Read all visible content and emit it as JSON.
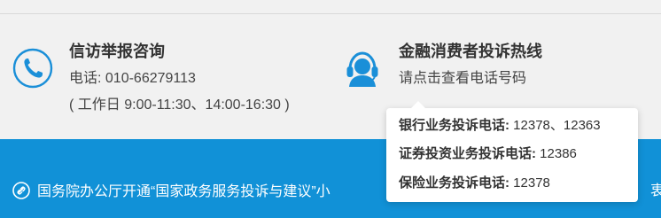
{
  "petition": {
    "title": "信访举报咨询",
    "phone": "电话: 010-66279113",
    "hours": "( 工作日 9:00-11:30、14:00-16:30 )",
    "icon": "phone-handset-icon"
  },
  "hotline": {
    "title": "金融消费者投诉热线",
    "link_text": "请点击查看电话号码",
    "icon": "headset-operator-icon"
  },
  "popup": {
    "rows": [
      {
        "label": "银行业务投诉电话:",
        "value": "12378、12363"
      },
      {
        "label": "证券投资业务投诉电话:",
        "value": "12386"
      },
      {
        "label": "保险业务投诉电话:",
        "value": "12378"
      }
    ]
  },
  "notice": {
    "text": "国务院办公厅开通“国家政务服务投诉与建议”小",
    "tail": "衷曲",
    "icon": "link-icon"
  },
  "colors": {
    "accent_blue": "#1191d7",
    "icon_blue": "#1a8fd8",
    "background": "#f1f1f1"
  }
}
